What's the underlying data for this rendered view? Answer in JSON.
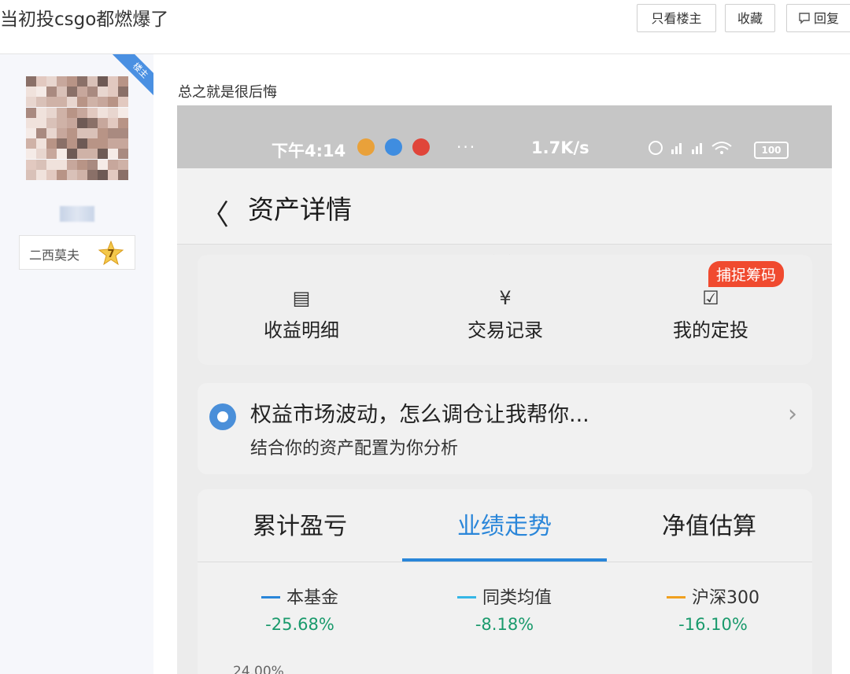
{
  "thread": {
    "title": "当初投csgo都燃爆了",
    "buttons": {
      "only_op": "只看楼主",
      "favorite": "收藏",
      "reply": "回复"
    }
  },
  "author": {
    "ribbon": "楼主",
    "badge_name": "二西莫夫",
    "level": "7"
  },
  "post": {
    "text": "总之就是很后悔"
  },
  "screenshot": {
    "status_bar": {
      "time": "下午4:14",
      "ellipsis": "···",
      "net_speed": "1.7K/s",
      "icons": "⍾ ⏰ HD▮ HD▮ ◠",
      "battery": "100"
    },
    "header": {
      "back": "〈",
      "title": "资产详情"
    },
    "quick_actions": [
      {
        "icon": "▤",
        "label": "收益明细"
      },
      {
        "icon": "¥",
        "label": "交易记录"
      },
      {
        "icon": "☑",
        "label": "我的定投"
      }
    ],
    "promo_tag": "捕捉筹码",
    "advice": {
      "title": "权益市场波动，怎么调仓让我帮你...",
      "subtitle": "结合你的资产配置为你分析",
      "arrow": "›"
    },
    "tabs": [
      "累计盈亏",
      "业绩走势",
      "净值估算"
    ],
    "active_tab": "业绩走势",
    "legend": [
      {
        "name": "本基金",
        "value": "-25.68%",
        "color": "#2a86d9"
      },
      {
        "name": "同类均值",
        "value": "-8.18%",
        "color": "#35b6e6"
      },
      {
        "name": "沪深300",
        "value": "-16.10%",
        "color": "#f0a020"
      }
    ],
    "axis_tick": "24.00%"
  },
  "colors": {
    "accent_blue": "#2a86d9",
    "ribbon_blue": "#4a90e2",
    "promo_red": "#f04a2f",
    "loss_green": "#1a9a6c"
  }
}
